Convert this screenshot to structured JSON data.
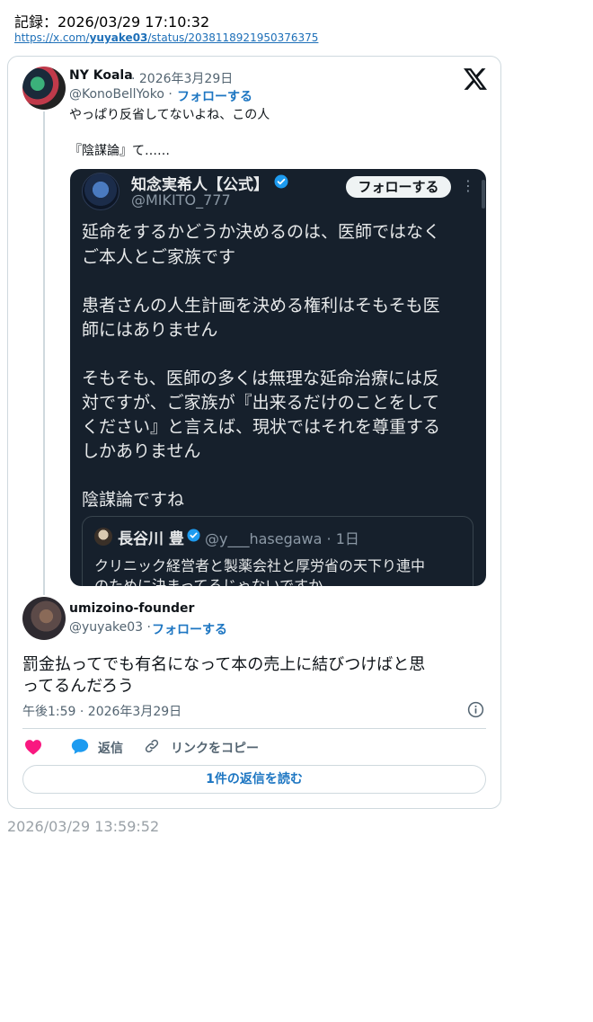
{
  "record": {
    "label": "記録：2026/03/29 17:10:32",
    "url_prefix": "https://x.com/",
    "url_user": "yuyake03",
    "url_suffix": "/status/2038118921950376375"
  },
  "tweet1": {
    "name": "NY Koala",
    "date": "· 2026年3月29日",
    "handle": "@KonoBellYoko ·",
    "follow": "フォローする",
    "lines": [
      "やっぱり反省してないよね、この人",
      "『陰謀論』て……"
    ]
  },
  "embed": {
    "name": "知念実希人【公式】",
    "handle": "@MIKITO_777",
    "follow": "フォローする",
    "more": "⋮",
    "lines": [
      "延命をするかどうか決めるのは、医師ではなく",
      "ご本人とご家族です",
      "患者さんの人生計画を決める権利はそもそも医",
      "師にはありません",
      "そもそも、医師の多くは無理な延命治療には反",
      "対ですが、ご家族が『出来るだけのことをして",
      "ください』と言えば、現状ではそれを尊重する",
      "しかありません",
      "陰謀論ですね"
    ],
    "quote": {
      "name": "長谷川 豊",
      "handle": "@y___hasegawa · 1日",
      "lines": [
        "クリニック経営者と製薬会社と厚労省の天下り連中",
        "のために決まってるじゃないですか"
      ]
    }
  },
  "tweet2": {
    "name": "umizoino-founder",
    "handle": "@yuyake03 ·",
    "follow": "フォローする",
    "lines": [
      "罰金払ってでも有名になって本の売上に結びつけばと思",
      "ってるんだろう"
    ],
    "time": "午後1:59 · 2026年3月29日"
  },
  "actions": {
    "reply": "返信",
    "copy_link": "リンクをコピー",
    "read_replies": "1件の返信を読む"
  },
  "footer": {
    "timestamp": "2026/03/29 13:59:52"
  },
  "colors": {
    "accent": "#1d76c2",
    "like": "#f91880",
    "verified": "#1d9bf0",
    "embed_bg": "#16202c"
  },
  "icons": [
    "x-logo-icon",
    "verified-badge-icon",
    "info-icon",
    "heart-icon",
    "reply-bubble-icon",
    "link-icon"
  ]
}
